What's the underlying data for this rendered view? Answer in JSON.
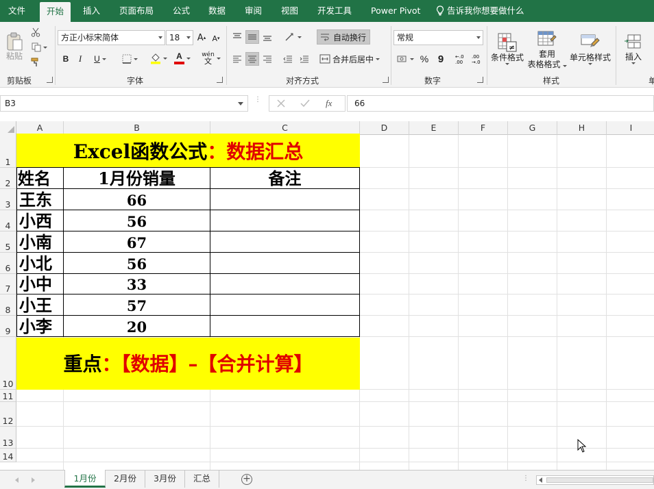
{
  "menu": {
    "tabs": [
      "文件",
      "开始",
      "插入",
      "页面布局",
      "公式",
      "数据",
      "审阅",
      "视图",
      "开发工具",
      "Power Pivot"
    ],
    "active_tab": "开始",
    "tell_me": "告诉我你想要做什么"
  },
  "ribbon": {
    "clipboard": {
      "label": "剪贴板",
      "paste_label": "粘贴"
    },
    "font": {
      "label": "字体",
      "font_name": "方正小标宋简体",
      "font_size": "18",
      "bold": "B",
      "italic": "I",
      "underline": "U",
      "grow": "A",
      "shrink": "A",
      "font_color": "A",
      "phonetic": "wén"
    },
    "alignment": {
      "label": "对齐方式",
      "wrap_text": "自动换行",
      "merge_center": "合并后居中"
    },
    "number": {
      "label": "数字",
      "format": "常规",
      "percent": "%",
      "comma": "9"
    },
    "styles": {
      "label": "样式",
      "conditional": "条件格式",
      "table_format_1": "套用",
      "table_format_2": "表格格式",
      "cell_styles": "单元格样式"
    },
    "cells": {
      "insert": "插入",
      "label_partial": "单"
    },
    "colors": {
      "accent": "#217346",
      "highlight": "#ffff00",
      "red_text": "#e00000"
    }
  },
  "formula_bar": {
    "name_box": "B3",
    "fx": "fx",
    "value": "66"
  },
  "grid": {
    "columns": [
      "A",
      "B",
      "C",
      "D",
      "E",
      "F",
      "G",
      "H",
      "I"
    ],
    "rows": [
      "1",
      "2",
      "3",
      "4",
      "5",
      "6",
      "7",
      "8",
      "9",
      "10",
      "11",
      "12",
      "13",
      "14"
    ],
    "title_black": "Excel函数公式",
    "title_red": "：数据汇总",
    "headers": [
      "姓名",
      "1月份销量",
      "备注"
    ],
    "data": [
      {
        "name": "王东",
        "sales": "66"
      },
      {
        "name": "小西",
        "sales": "56"
      },
      {
        "name": "小南",
        "sales": "67"
      },
      {
        "name": "小北",
        "sales": "56"
      },
      {
        "name": "小中",
        "sales": "33"
      },
      {
        "name": "小王",
        "sales": "57"
      },
      {
        "name": "小李",
        "sales": "20"
      }
    ],
    "note_black": "重点",
    "note_red": "：【数据】–【合并计算】"
  },
  "sheets": {
    "tabs": [
      "1月份",
      "2月份",
      "3月份",
      "汇总"
    ],
    "active": "1月份"
  }
}
